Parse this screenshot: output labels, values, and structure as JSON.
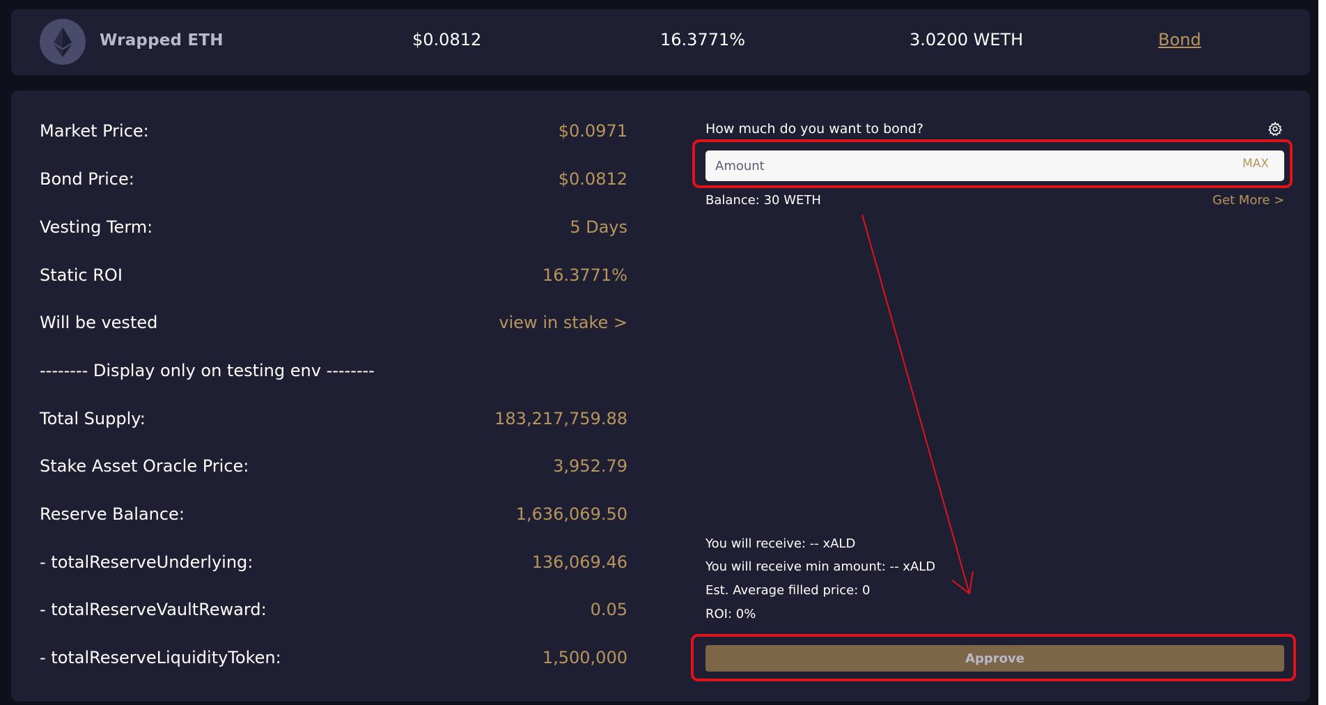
{
  "bond_row": {
    "token_name": "Wrapped ETH",
    "token_icon": "ethereum-icon",
    "price": "$0.0812",
    "roi": "16.3771%",
    "purchased": "3.0200 WETH",
    "bond_link": "Bond"
  },
  "details": {
    "rows": [
      {
        "label": "Market Price:",
        "value": "$0.0971"
      },
      {
        "label": "Bond Price:",
        "value": "$0.0812"
      },
      {
        "label": "Vesting Term:",
        "value": "5 Days"
      },
      {
        "label": "Static ROI",
        "value": "16.3771%"
      },
      {
        "label": "Will be vested",
        "value": "view in stake >"
      },
      {
        "label": "-------- Display only on testing env --------",
        "value": ""
      },
      {
        "label": "Total Supply:",
        "value": "183,217,759.88"
      },
      {
        "label": "Stake Asset Oracle Price:",
        "value": "3,952.79"
      },
      {
        "label": "Reserve Balance:",
        "value": "1,636,069.50"
      },
      {
        "label": "- totalReserveUnderlying:",
        "value": "136,069.46"
      },
      {
        "label": "- totalReserveVaultReward:",
        "value": "0.05"
      },
      {
        "label": "- totalReserveLiquidityToken:",
        "value": "1,500,000"
      }
    ]
  },
  "bond_form": {
    "question": "How much do you want to bond?",
    "settings_icon": "gear-icon",
    "amount_placeholder": "Amount",
    "amount_value": "",
    "max_label": "MAX",
    "balance": "Balance: 30 WETH",
    "get_more": "Get More >",
    "receive": "You will receive: -- xALD",
    "receive_min": "You will receive min amount: -- xALD",
    "avg_price": "Est. Average filled price: 0",
    "roi": "ROI: 0%",
    "approve_label": "Approve"
  },
  "colors": {
    "background": "#10101d",
    "panel": "#1f1f34",
    "accent_gold": "#b8955a",
    "approve_button": "#7c6647",
    "annotation_red": "#e0121a"
  }
}
